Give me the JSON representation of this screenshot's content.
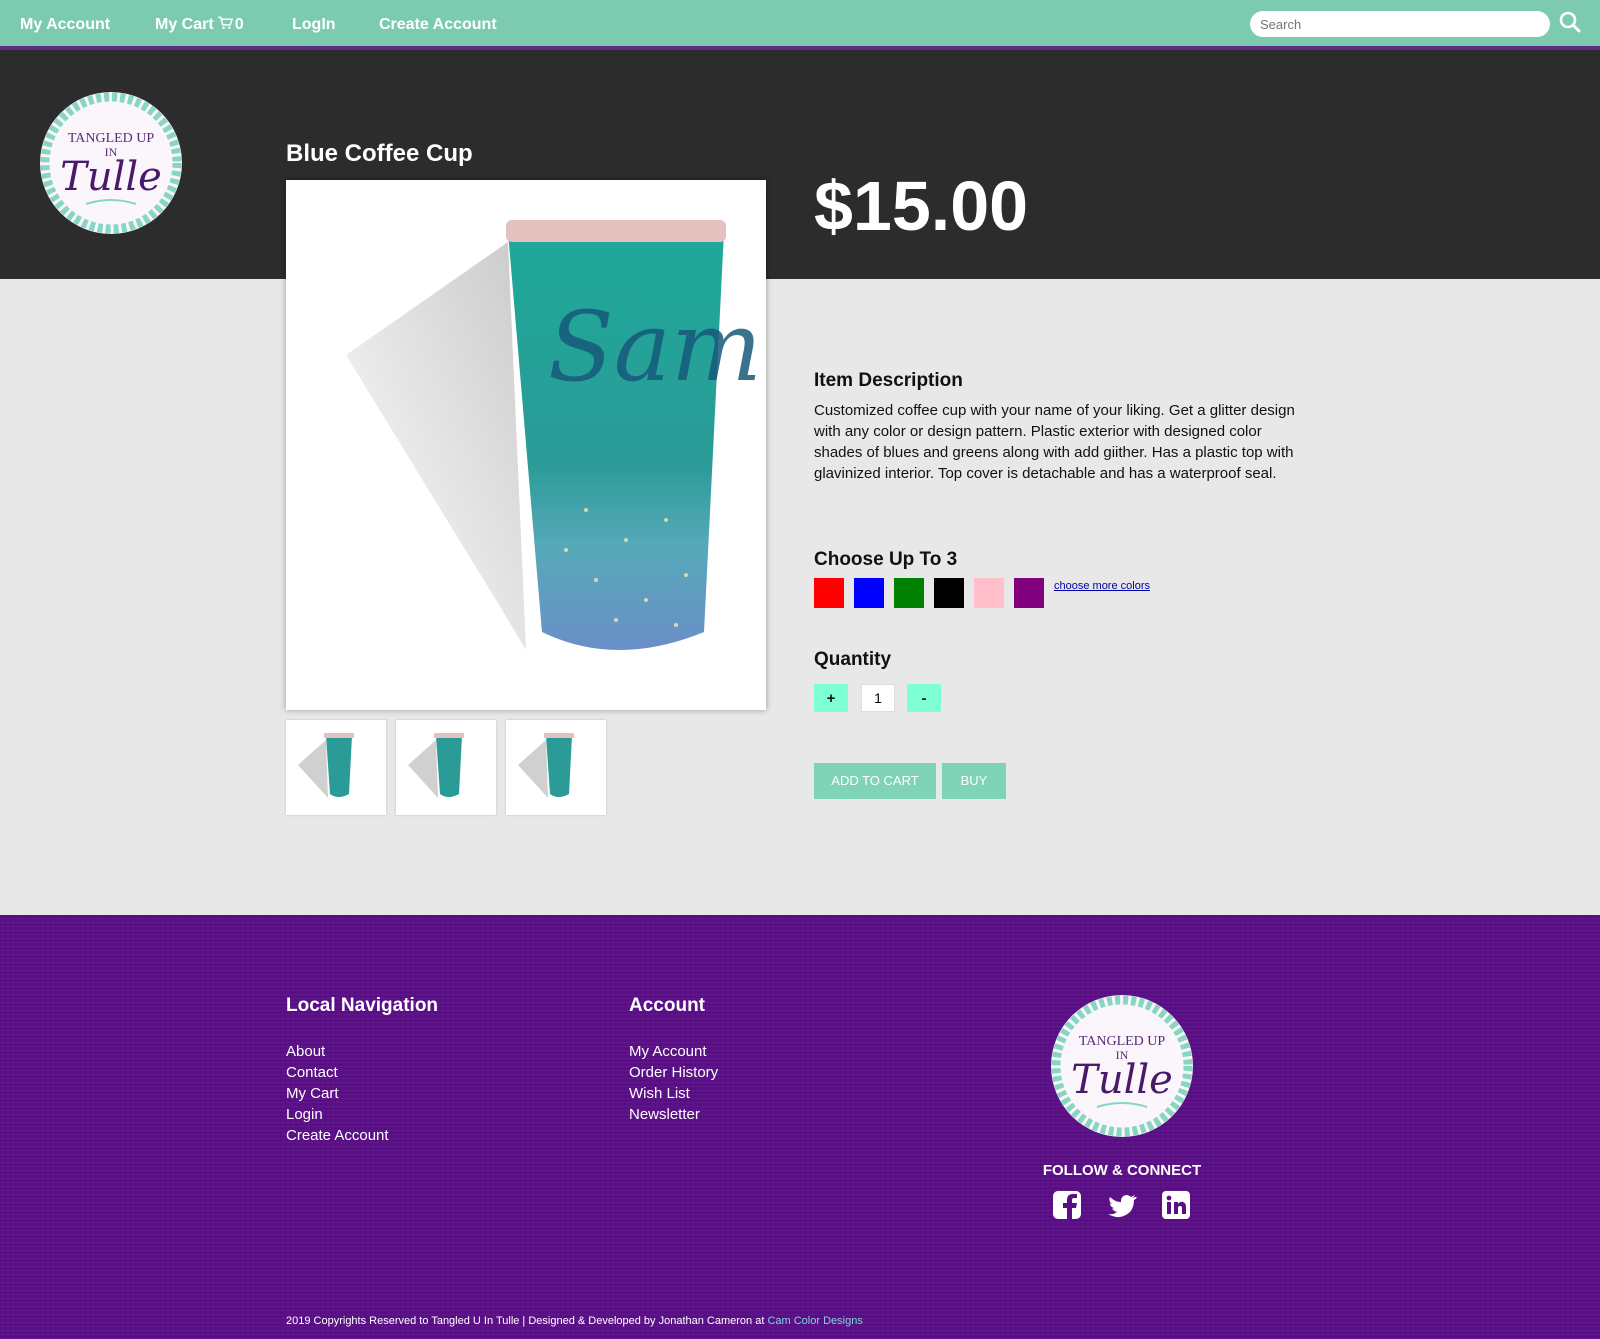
{
  "nav": {
    "my_account": "My Account",
    "my_cart": "My Cart",
    "cart_count": "0",
    "login": "LogIn",
    "create_account": "Create Account",
    "search_placeholder": "Search"
  },
  "logo": {
    "line1": "TANGLED UP",
    "line2": "IN",
    "line3": "Tulle"
  },
  "product": {
    "title": "Blue Coffee Cup",
    "price": "$15.00",
    "description_heading": "Item Description",
    "description": "Customized coffee cup with your name of your liking. Get a glitter design with any color or design pattern. Plastic exterior with designed color shades of blues and greens along with add giither. Has a plastic top with glavinized interior. Top cover is detachable and has a waterproof seal.",
    "cup_name": "Sam",
    "colors_heading": "Choose Up To 3",
    "colors": [
      "#ff0000",
      "#0000ff",
      "#008000",
      "#000000",
      "#ffc0cb",
      "#800080"
    ],
    "more_colors": "choose more colors",
    "quantity_heading": "Quantity",
    "plus": "+",
    "minus": "-",
    "quantity": "1",
    "add_to_cart": "ADD TO CART",
    "buy": "BUY"
  },
  "footer": {
    "local_heading": "Local Navigation",
    "local_links": [
      "About",
      "Contact",
      "My Cart",
      "Login",
      "Create Account"
    ],
    "account_heading": "Account",
    "account_links": [
      "My Account",
      "Order History",
      "Wish List",
      "Newsletter"
    ],
    "follow": "FOLLOW & CONNECT",
    "copyright": "2019 Copyrights Reserved to Tangled U In Tulle | Designed & Developed by Jonathan Cameron at",
    "credit_link": "Cam Color Designs"
  },
  "colors": {
    "nav_bg": "#7ccbb0",
    "hero_bg": "#2c2c2c",
    "footer_bg": "#5b0f87",
    "button_bg": "#7fd4b7",
    "qty_button_bg": "#7fffd4"
  }
}
